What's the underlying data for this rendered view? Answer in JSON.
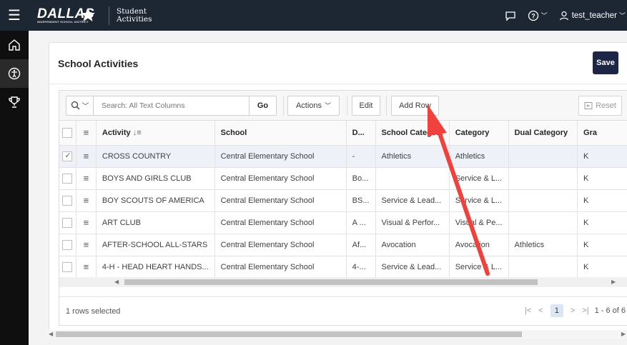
{
  "topbar": {
    "logo_text": "DALLAS",
    "logo_sub": "INDEPENDENT SCHOOL DISTRICT",
    "app_name_line1": "Student",
    "app_name_line2": "Activities",
    "user": "test_teacher"
  },
  "nav": {
    "items": [
      "home-icon",
      "accessibility-icon",
      "trophy-icon"
    ]
  },
  "page": {
    "title": "School Activities",
    "save_label": "Save"
  },
  "toolbar": {
    "search_placeholder": "Search: All Text Columns",
    "go_label": "Go",
    "actions_label": "Actions",
    "edit_label": "Edit",
    "add_row_label": "Add Row",
    "reset_label": "Reset"
  },
  "table": {
    "columns": [
      "Activity",
      "School",
      "D...",
      "School Catego...",
      "Category",
      "Dual Category",
      "Gra"
    ],
    "rows": [
      {
        "checked": true,
        "activity": "CROSS COUNTRY",
        "school": "Central Elementary School",
        "d": "-",
        "school_category": "Athletics",
        "category": "Athletics",
        "dual": "",
        "grade": "K"
      },
      {
        "checked": false,
        "activity": "BOYS AND GIRLS CLUB",
        "school": "Central Elementary School",
        "d": "Bo...",
        "school_category": "",
        "category": "Service & L...",
        "dual": "",
        "grade": "K"
      },
      {
        "checked": false,
        "activity": "BOY SCOUTS OF AMERICA",
        "school": "Central Elementary School",
        "d": "BS...",
        "school_category": "Service & Lead...",
        "category": "Service & L...",
        "dual": "",
        "grade": "K"
      },
      {
        "checked": false,
        "activity": "ART CLUB",
        "school": "Central Elementary School",
        "d": "A ...",
        "school_category": "Visual & Perfor...",
        "category": "Visual & Pe...",
        "dual": "",
        "grade": "K"
      },
      {
        "checked": false,
        "activity": "AFTER-SCHOOL ALL-STARS",
        "school": "Central Elementary School",
        "d": "Af...",
        "school_category": "Avocation",
        "category": "Avocation",
        "dual": "Athletics",
        "grade": "K"
      },
      {
        "checked": false,
        "activity": "4-H - HEAD HEART HANDS...",
        "school": "Central Elementary School",
        "d": "4-...",
        "school_category": "Service & Lead...",
        "category": "Service & L...",
        "dual": "",
        "grade": "K"
      }
    ]
  },
  "footer": {
    "rows_selected": "1 rows selected",
    "current_page": "1",
    "range": "1 - 6 of 6"
  },
  "colors": {
    "topbar": "#1d2733",
    "save": "#1d2745",
    "annotation_arrow": "#f0413c"
  }
}
